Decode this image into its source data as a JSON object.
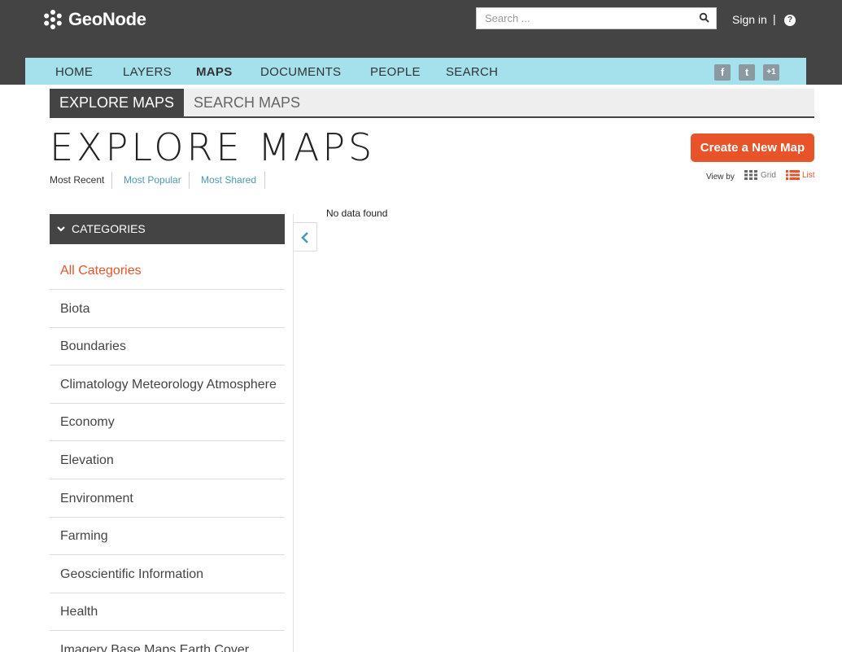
{
  "header": {
    "logo_text": "GeoNode",
    "search_placeholder": "Search ...",
    "signin_label": "Sign in",
    "separator": "|",
    "help_label": "?"
  },
  "nav": {
    "items": [
      {
        "label": "HOME",
        "active": false
      },
      {
        "label": "LAYERS",
        "active": false
      },
      {
        "label": "MAPS",
        "active": true
      },
      {
        "label": "DOCUMENTS",
        "active": false
      },
      {
        "label": "PEOPLE",
        "active": false
      },
      {
        "label": "SEARCH",
        "active": false
      }
    ],
    "social": [
      {
        "icon": "facebook-icon",
        "glyph": "f"
      },
      {
        "icon": "twitter-icon",
        "glyph": "t"
      },
      {
        "icon": "google-plus-icon",
        "glyph": "+1"
      }
    ]
  },
  "tabs": {
    "explore": "EXPLORE MAPS",
    "search": "SEARCH MAPS"
  },
  "page": {
    "title": "EXPLORE MAPS",
    "create_button": "Create a New Map"
  },
  "sort": {
    "recent": "Most Recent",
    "popular": "Most Popular",
    "shared": "Most Shared"
  },
  "view": {
    "label": "View by",
    "grid": "Grid",
    "list": "List"
  },
  "categories": {
    "header": "CATEGORIES",
    "items": [
      "All Categories",
      "Biota",
      "Boundaries",
      "Climatology Meteorology Atmosphere",
      "Economy",
      "Elevation",
      "Environment",
      "Farming",
      "Geoscientific Information",
      "Health",
      "Imagery Base Maps Earth Cover"
    ]
  },
  "results": {
    "empty_message": "No data found"
  },
  "colors": {
    "topbar": "#444444",
    "nav": "#a4e1ec",
    "accent": "#e8532a",
    "link": "#4a9ab3"
  }
}
